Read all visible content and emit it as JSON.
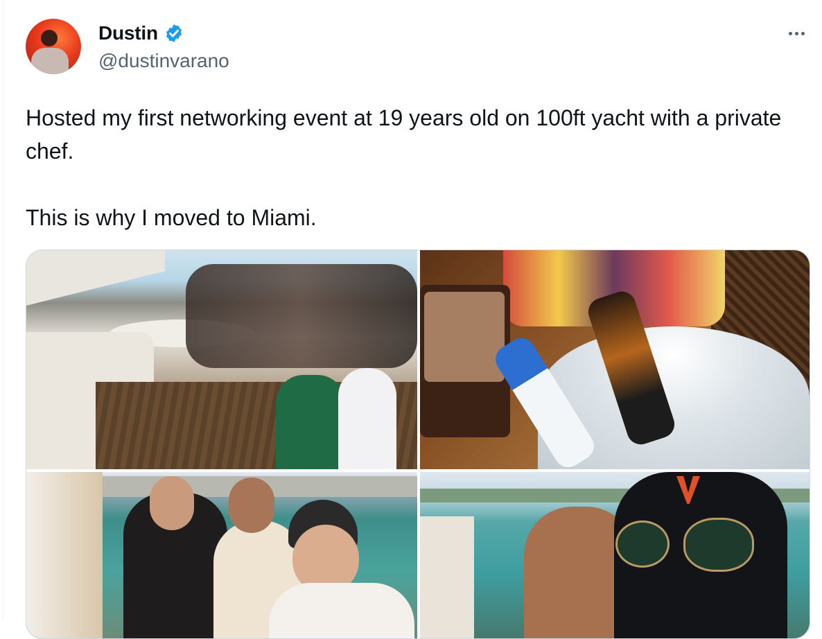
{
  "author": {
    "display_name": "Dustin",
    "handle": "@dustinvarano",
    "verified": true,
    "avatar_icon": "profile-photo",
    "verified_icon": "verified-badge-icon",
    "more_icon": "more-options-icon"
  },
  "tweet": {
    "paragraphs": [
      "Hosted my first networking event at 19 years old on 100ft yacht with a private chef.",
      "This is why I moved to Miami."
    ]
  },
  "media": {
    "count": 4,
    "photos": [
      {
        "name": "group-on-yacht-deck-photo"
      },
      {
        "name": "fruit-platter-and-ice-bucket-photo"
      },
      {
        "name": "friends-on-yacht-photo"
      },
      {
        "name": "ski-mask-sunglasses-photo"
      }
    ]
  },
  "colors": {
    "text_primary": "#0f1419",
    "text_secondary": "#536471",
    "verified_blue": "#1d9bf0",
    "border": "#cfd9de"
  }
}
